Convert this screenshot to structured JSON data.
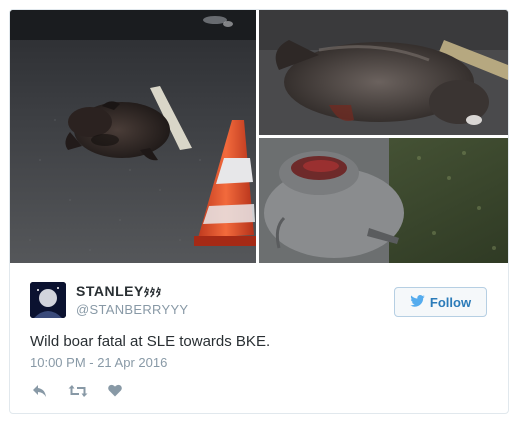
{
  "tweet": {
    "author": {
      "display_name": "STANLEY",
      "name_glyph": "ﾀﾀﾀ",
      "handle": "@STANBERRYYY"
    },
    "follow_button": {
      "label": "Follow",
      "icon": "twitter-bird-icon"
    },
    "text": "Wild boar fatal at SLE towards BKE.",
    "timestamp": "10:00 PM - 21 Apr 2016",
    "actions": [
      {
        "name": "reply",
        "icon": "reply-icon"
      },
      {
        "name": "retweet",
        "icon": "retweet-icon"
      },
      {
        "name": "like",
        "icon": "heart-icon"
      }
    ],
    "media_count": 3
  },
  "colors": {
    "text": "#292f33",
    "secondary_text": "#8899a6",
    "accent": "#2b7bb9",
    "border": "#e1e8ed",
    "action_icon": "#8899a6"
  }
}
